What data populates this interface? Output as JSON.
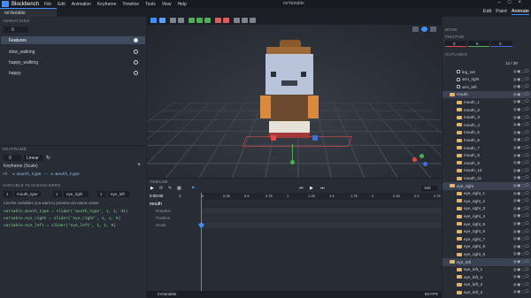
{
  "app": {
    "name": "Blockbench",
    "window_title": "mrVariable",
    "menu": [
      "File",
      "Edit",
      "Animation",
      "Keyframe",
      "Timeline",
      "Tools",
      "View",
      "Help"
    ]
  },
  "project_tab": "mrVariable",
  "modes": [
    "Edit",
    "Paint",
    "Animate"
  ],
  "animations": {
    "title": "ANIMATIONS",
    "group": "0",
    "items": [
      {
        "name": "Features",
        "selected": true
      },
      {
        "name": "slow_walking"
      },
      {
        "name": "happy_walking"
      },
      {
        "name": "happy"
      }
    ]
  },
  "keyframe": {
    "title": "KEYFRAME",
    "value": "0",
    "interpolation": "Linear",
    "label": "Keyframe (Scale)",
    "axis": "All",
    "expression": "v.mouth_type -- v.mouth_type"
  },
  "variables": {
    "title": "VARIABLE PLACEHOLDERS",
    "field1": "1",
    "field2": "mouth_type",
    "field3": "1",
    "field4": "eye_right",
    "field5": "1",
    "field6": "eye_left",
    "hint": "List the variables you want to preview via name=value",
    "lines": [
      "variable.mouth_type = slider('mouth_type', 1, 1, 31)",
      "variable.eye_right = slider('eye_right', 1, 1, 9)",
      "variable.eye_left = slider('eye_left', 1, 1, 9)"
    ]
  },
  "timeline": {
    "title": "TIMELINE",
    "time": "0:00:00",
    "length": "1",
    "zoom": "100",
    "group": "mouth",
    "channels": [
      "Rotation",
      "Position",
      "Scale"
    ],
    "ticks": [
      "0",
      "0.25",
      "0.5",
      "0.75",
      "1",
      "1.25",
      "1.5",
      "1.75",
      "2",
      "2.25",
      "2.5",
      "2.75"
    ]
  },
  "bone": {
    "title": "BONE",
    "pivot_label": "Pivot Point",
    "values": [
      "0",
      "5",
      "0"
    ]
  },
  "outliner": {
    "title": "OUTLINER",
    "count": "12 / 38",
    "rows": [
      {
        "name": "leg_set",
        "type": "cube",
        "indent": 1
      },
      {
        "name": "arm_right",
        "type": "cube",
        "indent": 1
      },
      {
        "name": "arm_left",
        "type": "cube",
        "indent": 1
      },
      {
        "name": "mouth",
        "type": "group",
        "indent": 0
      },
      {
        "name": "mouth_1",
        "type": "folder",
        "indent": 1
      },
      {
        "name": "mouth_2",
        "type": "folder",
        "indent": 1
      },
      {
        "name": "mouth_3",
        "type": "folder",
        "indent": 1
      },
      {
        "name": "mouth_4",
        "type": "folder",
        "indent": 1
      },
      {
        "name": "mouth_5",
        "type": "folder",
        "indent": 1
      },
      {
        "name": "mouth_6",
        "type": "folder",
        "indent": 1
      },
      {
        "name": "mouth_7",
        "type": "folder",
        "indent": 1
      },
      {
        "name": "mouth_8",
        "type": "folder",
        "indent": 1
      },
      {
        "name": "mouth_9",
        "type": "folder",
        "indent": 1
      },
      {
        "name": "mouth_10",
        "type": "folder",
        "indent": 1
      },
      {
        "name": "mouth_11",
        "type": "folder",
        "indent": 1
      },
      {
        "name": "eye_right",
        "type": "group",
        "indent": 0
      },
      {
        "name": "eye_right_1",
        "type": "folder",
        "indent": 1
      },
      {
        "name": "eye_right_2",
        "type": "folder",
        "indent": 1
      },
      {
        "name": "eye_right_3",
        "type": "folder",
        "indent": 1
      },
      {
        "name": "eye_right_4",
        "type": "folder",
        "indent": 1
      },
      {
        "name": "eye_right_5",
        "type": "folder",
        "indent": 1
      },
      {
        "name": "eye_right_6",
        "type": "folder",
        "indent": 1
      },
      {
        "name": "eye_right_7",
        "type": "folder",
        "indent": 1
      },
      {
        "name": "eye_right_8",
        "type": "folder",
        "indent": 1
      },
      {
        "name": "eye_right_9",
        "type": "folder",
        "indent": 1
      },
      {
        "name": "eye_left",
        "type": "group",
        "indent": 0
      },
      {
        "name": "eye_left_1",
        "type": "folder",
        "indent": 1
      },
      {
        "name": "eye_left_2",
        "type": "folder",
        "indent": 1
      },
      {
        "name": "eye_left_3",
        "type": "folder",
        "indent": 1
      },
      {
        "name": "eye_left_4",
        "type": "folder",
        "indent": 1
      }
    ]
  },
  "status": {
    "project": "mrVariable",
    "fps": "60 FPS"
  },
  "colors": {
    "accent": "#3e90ff",
    "panel": "#282c34",
    "bg": "#21252b"
  }
}
